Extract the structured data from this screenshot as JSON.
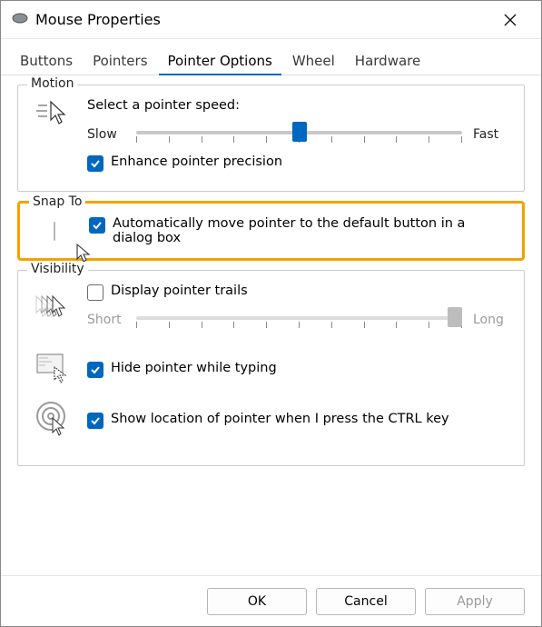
{
  "window": {
    "title": "Mouse Properties"
  },
  "tabs": {
    "items": [
      {
        "label": "Buttons",
        "active": false
      },
      {
        "label": "Pointers",
        "active": false
      },
      {
        "label": "Pointer Options",
        "active": true
      },
      {
        "label": "Wheel",
        "active": false
      },
      {
        "label": "Hardware",
        "active": false
      }
    ]
  },
  "motion": {
    "group_label": "Motion",
    "heading": "Select a pointer speed:",
    "slow_label": "Slow",
    "fast_label": "Fast",
    "speed_value": 5,
    "speed_ticks": 11,
    "enhance_label": "Enhance pointer precision",
    "enhance_checked": true
  },
  "snapto": {
    "group_label": "Snap To",
    "auto_label": "Automatically move pointer to the default button in a dialog box",
    "auto_checked": true
  },
  "visibility": {
    "group_label": "Visibility",
    "trails_label": "Display pointer trails",
    "trails_checked": false,
    "short_label": "Short",
    "long_label": "Long",
    "trails_length": 10,
    "trails_ticks": 11,
    "hide_label": "Hide pointer while typing",
    "hide_checked": true,
    "ctrl_label": "Show location of pointer when I press the CTRL key",
    "ctrl_checked": true
  },
  "footer": {
    "ok_label": "OK",
    "cancel_label": "Cancel",
    "apply_label": "Apply",
    "apply_enabled": false
  }
}
